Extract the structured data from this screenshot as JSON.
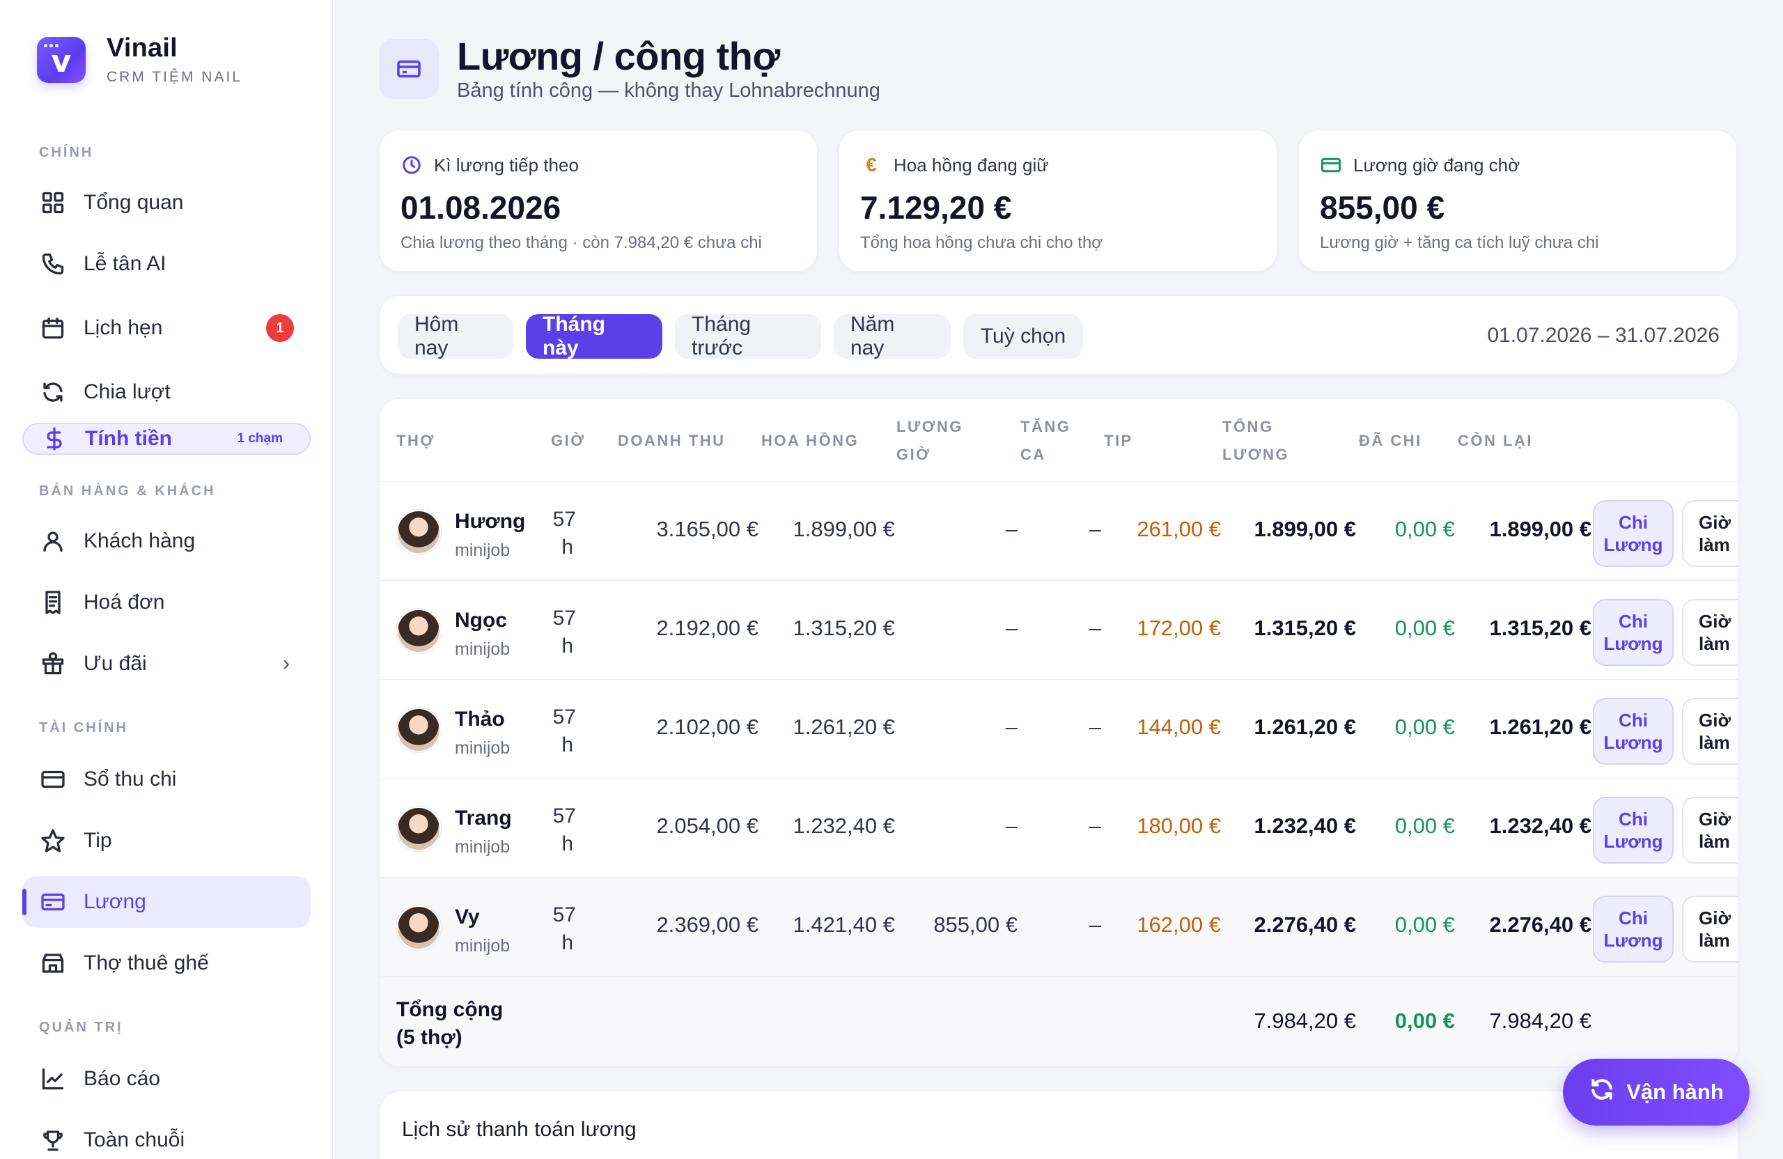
{
  "app": {
    "name": "Vinail",
    "subtitle": "CRM TIỆM NAIL"
  },
  "sidebar": {
    "sections": {
      "main": "CHÍNH",
      "sales": "BÁN HÀNG & KHÁCH",
      "finance": "TÀI CHÍNH",
      "admin": "QUẢN TRỊ"
    },
    "items": [
      {
        "label": "Tổng quan",
        "icon": "grid-icon"
      },
      {
        "label": "Lễ tân AI",
        "icon": "phone-icon"
      },
      {
        "label": "Lịch hẹn",
        "icon": "calendar-icon",
        "badge": "1"
      },
      {
        "label": "Chia lượt",
        "icon": "refresh-icon"
      },
      {
        "label": "Tính tiền",
        "icon": "dollar-icon",
        "tag": "1 chạm"
      },
      {
        "label": "Khách hàng",
        "icon": "user-icon"
      },
      {
        "label": "Hoá đơn",
        "icon": "receipt-icon"
      },
      {
        "label": "Ưu đãi",
        "icon": "gift-icon",
        "chevron": "›"
      },
      {
        "label": "Sổ thu chi",
        "icon": "card-icon"
      },
      {
        "label": "Tip",
        "icon": "star-icon"
      },
      {
        "label": "Lương",
        "icon": "wallet-icon",
        "active": true
      },
      {
        "label": "Thợ thuê ghế",
        "icon": "store-icon"
      },
      {
        "label": "Báo cáo",
        "icon": "chart-icon"
      },
      {
        "label": "Toàn chuỗi",
        "icon": "trophy-icon"
      }
    ]
  },
  "header": {
    "title": "Lương / công thợ",
    "subtitle": "Bảng tính công — không thay Lohnabrechnung"
  },
  "stats": [
    {
      "label": "Kì lương tiếp theo",
      "value": "01.08.2026",
      "note": "Chia lương theo tháng · còn 7.984,20 € chưa chi",
      "icon": "clock-icon",
      "color": "#5b3fe8"
    },
    {
      "label": "Hoa hồng đang giữ",
      "value": "7.129,20 €",
      "note": "Tổng hoa hồng chưa chi cho thợ",
      "icon": "euro-icon",
      "color": "#d08a12"
    },
    {
      "label": "Lương giờ đang chờ",
      "value": "855,00 €",
      "note": "Lương giờ + tăng ca tích luỹ chưa chi",
      "icon": "card-icon",
      "color": "#14955a"
    }
  ],
  "filters": {
    "tabs": [
      "Hôm nay",
      "Tháng này",
      "Tháng trước",
      "Năm nay",
      "Tuỳ chọn"
    ],
    "active": "Tháng này",
    "range": "01.07.2026 – 31.07.2026"
  },
  "table": {
    "headers": {
      "tho": "THỢ",
      "gio": "GIỜ",
      "doanh_thu": "DOANH THU",
      "hoa_hong": "HOA HỒNG",
      "luong_gio_1": "LƯƠNG",
      "luong_gio_2": "GIỜ",
      "tang_ca_1": "TĂNG",
      "tang_ca_2": "CA",
      "tip": "TIP",
      "tong_luong_1": "TỔNG",
      "tong_luong_2": "LƯƠNG",
      "da_chi": "ĐÃ CHI",
      "con_lai": "CÒN LẠI"
    },
    "rows": [
      {
        "name": "Hương",
        "type": "minijob",
        "hours": "57",
        "unit": "h",
        "revenue": "3.165,00 €",
        "commission": "1.899,00 €",
        "hourly": "–",
        "overtime": "–",
        "tip": "261,00 €",
        "total": "1.899,00 €",
        "paid": "0,00 €",
        "remaining": "1.899,00 €"
      },
      {
        "name": "Ngọc",
        "type": "minijob",
        "hours": "57",
        "unit": "h",
        "revenue": "2.192,00 €",
        "commission": "1.315,20 €",
        "hourly": "–",
        "overtime": "–",
        "tip": "172,00 €",
        "total": "1.315,20 €",
        "paid": "0,00 €",
        "remaining": "1.315,20 €"
      },
      {
        "name": "Thảo",
        "type": "minijob",
        "hours": "57",
        "unit": "h",
        "revenue": "2.102,00 €",
        "commission": "1.261,20 €",
        "hourly": "–",
        "overtime": "–",
        "tip": "144,00 €",
        "total": "1.261,20 €",
        "paid": "0,00 €",
        "remaining": "1.261,20 €"
      },
      {
        "name": "Trang",
        "type": "minijob",
        "hours": "57",
        "unit": "h",
        "revenue": "2.054,00 €",
        "commission": "1.232,40 €",
        "hourly": "–",
        "overtime": "–",
        "tip": "180,00 €",
        "total": "1.232,40 €",
        "paid": "0,00 €",
        "remaining": "1.232,40 €"
      },
      {
        "name": "Vy",
        "type": "minijob",
        "hours": "57",
        "unit": "h",
        "revenue": "2.369,00 €",
        "commission": "1.421,40 €",
        "hourly": "855,00 €",
        "overtime": "–",
        "tip": "162,00 €",
        "total": "2.276,40 €",
        "paid": "0,00 €",
        "remaining": "2.276,40 €"
      }
    ],
    "row_buttons": {
      "chi_1": "Chi",
      "chi_2": "Lương",
      "gio_1": "Giờ",
      "gio_2": "làm"
    },
    "totals": {
      "label_1": "Tổng cộng",
      "label_2": "(5 thợ)",
      "total": "7.984,20 €",
      "paid": "0,00 €",
      "remaining": "7.984,20 €"
    }
  },
  "history": {
    "title": "Lịch sử thanh toán lương"
  },
  "fab": {
    "label": "Vận hành",
    "icon": "refresh-icon"
  }
}
